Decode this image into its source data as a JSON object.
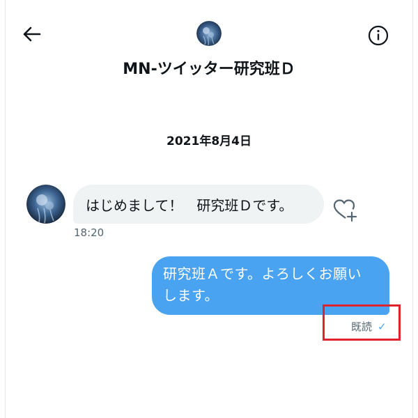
{
  "header": {
    "title": "MN-ツイッター研究班Ｄ",
    "back_icon": "arrow-left-icon",
    "info_icon": "info-circle-icon"
  },
  "conversation": {
    "date": "2021年8月4日",
    "messages": [
      {
        "direction": "incoming",
        "text": "はじめまして！　研究班Ｄです。",
        "time": "18:20"
      },
      {
        "direction": "outgoing",
        "lines": [
          "研究班Ａです。よろしくお願い",
          "します。"
        ],
        "status": "既読",
        "status_icon": "checkmark-icon"
      }
    ]
  },
  "colors": {
    "outgoing_bubble": "#4aa3f0",
    "incoming_bubble": "#eff3f4",
    "annotation_box": "#e0222d"
  }
}
